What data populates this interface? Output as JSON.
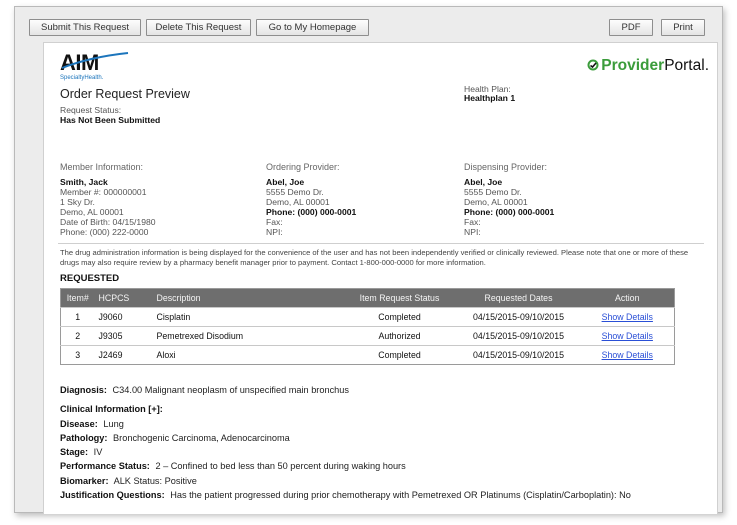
{
  "toolbar": {
    "submit": "Submit This Request",
    "delete": "Delete This Request",
    "home": "Go to My Homepage",
    "pdf": "PDF",
    "print": "Print"
  },
  "brand": {
    "aim_main": "AIM",
    "aim_sub": "SpecialtyHealth.",
    "provider_green": "Provider",
    "provider_rest": "Portal",
    "provider_dot": ".",
    "green": "#3b9c3b",
    "blue": "#1c75bc"
  },
  "header": {
    "title": "Order Request Preview",
    "status_label": "Request Status:",
    "status_value": "Has Not Been Submitted",
    "plan_label": "Health Plan:",
    "plan_value": "Healthplan 1"
  },
  "member": {
    "heading": "Member Information:",
    "name": "Smith, Jack",
    "number": "Member #: 000000001",
    "address1": "1 Sky Dr.",
    "address2": "Demo, AL 00001",
    "dob": "Date of Birth: 04/15/1980",
    "phone": "Phone: (000) 222-0000"
  },
  "ordering": {
    "heading": "Ordering Provider:",
    "name": "Abel, Joe",
    "address1": "5555 Demo Dr.",
    "address2": "Demo, AL 00001",
    "phone": "Phone: (000) 000-0001",
    "fax": "Fax:",
    "npi": "NPI:"
  },
  "dispensing": {
    "heading": "Dispensing Provider:",
    "name": "Abel, Joe",
    "address1": "5555 Demo Dr.",
    "address2": "Demo, AL 00001",
    "phone": "Phone: (000) 000-0001",
    "fax": "Fax:",
    "npi": "NPI:"
  },
  "disclaimer": "The drug administration information is being displayed for the convenience of the user and has not been independently verified or clinically reviewed. Please note that one or more of these drugs may also require review by a pharmacy benefit manager prior to payment. Contact 1-800-000-0000 for more information.",
  "requested": {
    "heading": "REQUESTED",
    "columns": [
      "Item#",
      "HCPCS",
      "Description",
      "Item Request Status",
      "Requested Dates",
      "Action"
    ],
    "rows": [
      {
        "item": "1",
        "hcpcs": "J9060",
        "description": "Cisplatin",
        "status": "Completed",
        "dates": "04/15/2015-09/10/2015",
        "action": "Show Details"
      },
      {
        "item": "2",
        "hcpcs": "J9305",
        "description": "Pemetrexed Disodium",
        "status": "Authorized",
        "dates": "04/15/2015-09/10/2015",
        "action": "Show Details"
      },
      {
        "item": "3",
        "hcpcs": "J2469",
        "description": "Aloxi",
        "status": "Completed",
        "dates": "04/15/2015-09/10/2015",
        "action": "Show Details"
      }
    ]
  },
  "details": {
    "diagnosis_label": "Diagnosis:",
    "diagnosis_value": "C34.00 Malignant neoplasm of unspecified main bronchus",
    "clinical_label": "Clinical Information [+]:",
    "disease_label": "Disease:",
    "disease_value": "Lung",
    "pathology_label": "Pathology:",
    "pathology_value": "Bronchogenic Carcinoma, Adenocarcinoma",
    "stage_label": "Stage:",
    "stage_value": "IV",
    "performance_label": "Performance Status:",
    "performance_value": "2 – Confined to bed less than 50 percent during waking hours",
    "biomarker_label": "Biomarker:",
    "biomarker_value": "ALK Status: Positive",
    "justification_label": "Justification Questions:",
    "justification_value": "Has the patient progressed during prior chemotherapy with Pemetrexed OR Platinums (Cisplatin/Carboplatin): No"
  }
}
